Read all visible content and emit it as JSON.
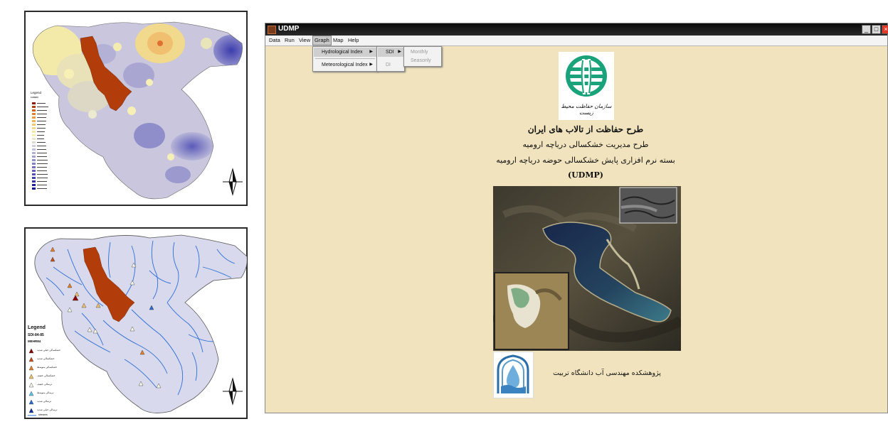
{
  "window": {
    "title": "UDMP",
    "min_label": "_",
    "max_label": "□",
    "close_label": "×"
  },
  "menu": {
    "items": [
      "Data",
      "Run",
      "View",
      "Graph",
      "Map",
      "Help"
    ],
    "active": "Graph"
  },
  "graph_menu": {
    "items": [
      "Hydrological Index",
      "Meteorological Index"
    ]
  },
  "index_submenu": {
    "items": [
      "SDI",
      "DI"
    ]
  },
  "sdi_submenu": {
    "items": [
      "Monthly",
      "Seasonly"
    ]
  },
  "content": {
    "title_line1": "طرح حفاظت از تالاب های ایران",
    "title_line2": "طرح مدیریت خشکسالی دریاچه ارومیه",
    "title_line3": "بسته نرم افزاری پایش خشکسالی حوضه دریاچه ارومیه",
    "title_line4": "(UDMP)",
    "logo_caption": "سازمان حفاظت محیط زیست",
    "institute": "پژوهشکده مهندسی آب دانشگاه تربیت"
  },
  "map_top": {
    "legend_title": "Legend",
    "legend_sub": "sustain",
    "colors": [
      "#f6f0b6",
      "#f1d98d",
      "#b7b4d6",
      "#8f8ecb",
      "#5c5cb8",
      "#2a2a9e"
    ]
  },
  "map_bottom": {
    "legend_title": "Legend",
    "legend_sub1": "SDI-84-85",
    "legend_sub2": "MEHR84",
    "legend_items": [
      "خشکسالی خیلی شدید",
      "خشکسالی شدید",
      "خشکسالی متوسط",
      "خشکسالی خفیف",
      "ترسالی خفیف",
      "ترسالی متوسط",
      "ترسالی شدید",
      "ترسالی خیلی شدید",
      "streams"
    ],
    "legend_colors": [
      "#8b0000",
      "#c0501a",
      "#e0802a",
      "#f0c070",
      "#f5f5e8",
      "#5bc6e8",
      "#2a6ad0",
      "#1030a0",
      "#2a7ad8"
    ]
  },
  "colors": {
    "window_bg": "#f0e3bd",
    "basin_brown": "#b23d0b",
    "basin_fill": "#d8d9ec",
    "stream_blue": "#2d6fd6"
  }
}
